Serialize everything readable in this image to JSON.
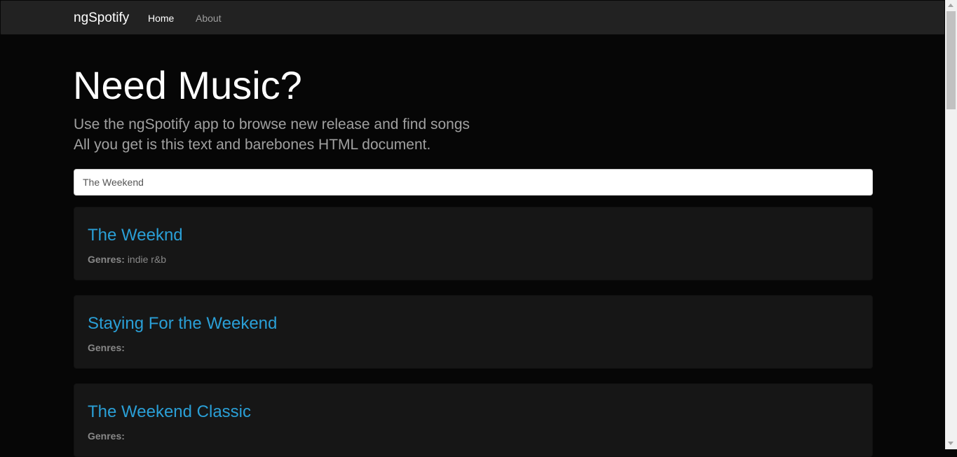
{
  "nav": {
    "brand": "ngSpotify",
    "home": "Home",
    "about": "About"
  },
  "hero": {
    "title": "Need Music?",
    "line1": "Use the ngSpotify app to browse new release and find songs",
    "line2": "All you get is this text and barebones HTML document."
  },
  "search": {
    "value": "The Weekend"
  },
  "results": [
    {
      "name": "The Weeknd",
      "genres_label": "Genres:",
      "genres": "indie r&b"
    },
    {
      "name": "Staying For the Weekend",
      "genres_label": "Genres:",
      "genres": ""
    },
    {
      "name": "The Weekend Classic",
      "genres_label": "Genres:",
      "genres": ""
    }
  ],
  "colors": {
    "background": "#060606",
    "navbar": "#222222",
    "card": "#161616",
    "link": "#2a9fd6"
  }
}
